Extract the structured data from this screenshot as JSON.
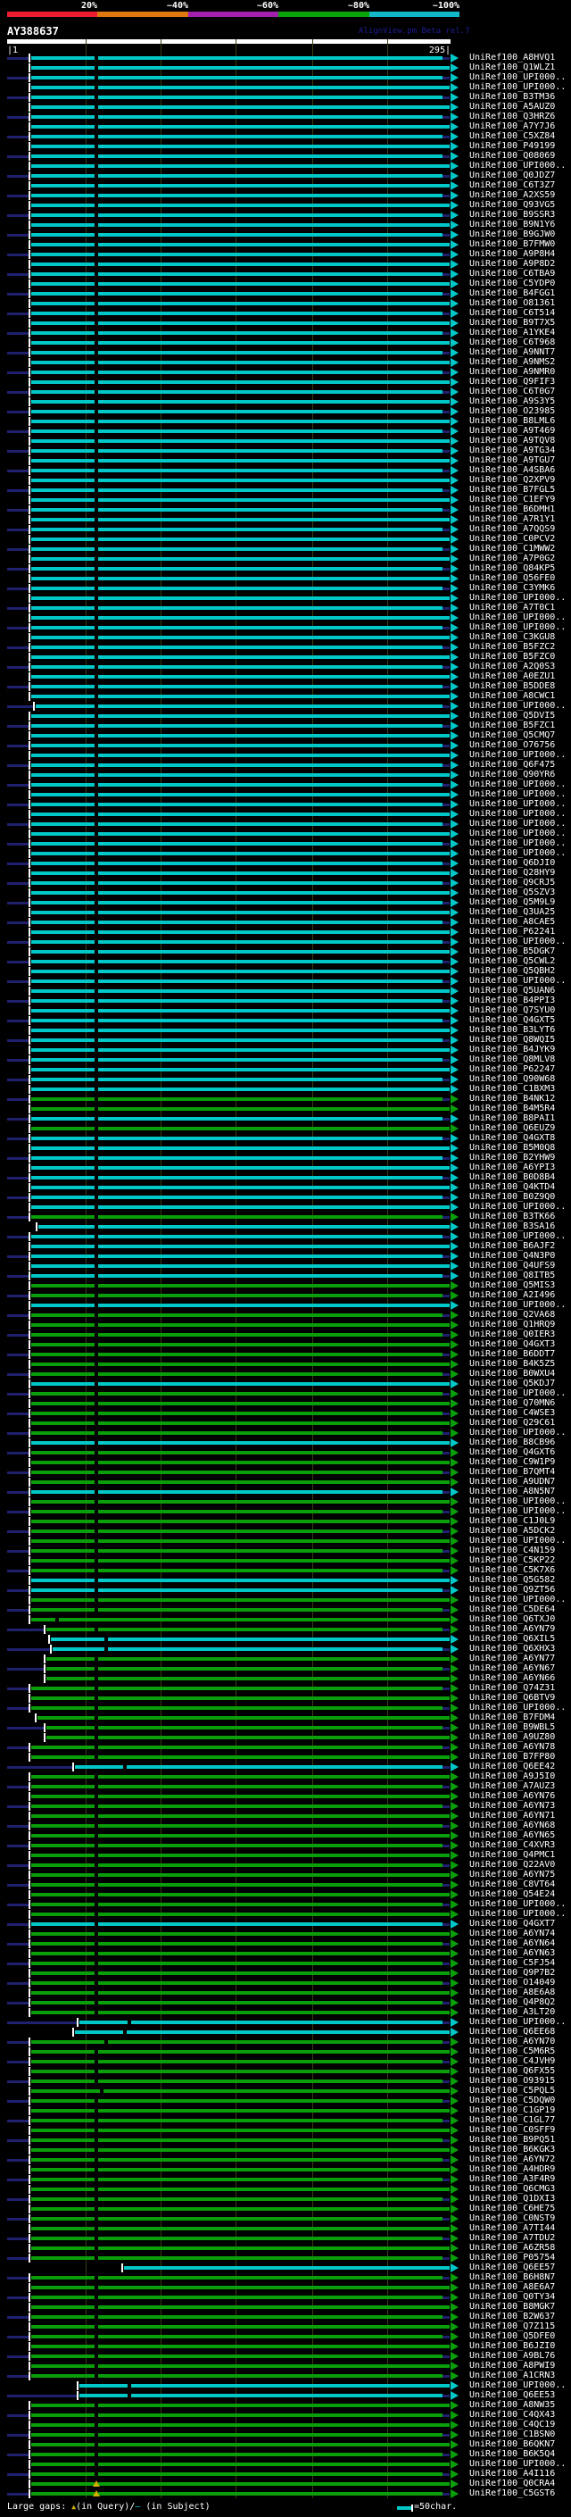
{
  "colors": {
    "background": "#000000",
    "bar_cyan": "#00C8C8",
    "bar_green": "#0A9E0A",
    "overhang_navy": "#20206E",
    "gridline": "#3C3C14",
    "text": "#FFFFFF",
    "watermark": "#1E1E96",
    "gap_marker_yellow": "#D0B000",
    "start_tick": "#FFFFFF"
  },
  "chart_data": {
    "type": "bar",
    "title": "AY388637",
    "watermark": "AlignView.pm Beta rel.7",
    "query_length": 295,
    "axis": {
      "start_label": "|1",
      "end_label": "295|"
    },
    "identity_scale": {
      "labels": [
        "20%",
        "~40%",
        "~60%",
        "~80%",
        "~100%"
      ],
      "colors": [
        "#ED1C2E",
        "#E07810",
        "#A220AA",
        "#0AA40A",
        "#12B8C8"
      ]
    },
    "legend": {
      "large_gaps_prefix": "Large gaps: ",
      "query_gap_symbol": "▲",
      "mid": "(in Query)/",
      "subject_gap_symbol": "—",
      "suffix": " (in Subject)",
      "scale_sample": "=50char."
    },
    "hit_prefix": "UniRef100_",
    "row_fields": [
      "accession",
      "identity_bin",
      "query_start_res",
      "large_gap_res",
      "query_gap_marker"
    ],
    "identity_bins": {
      "c": "~100%",
      "g": "~80%"
    },
    "gridlines_res": [
      53,
      103,
      153,
      204,
      254
    ],
    "rows": [
      [
        "A8HVQ1",
        "c",
        17,
        59
      ],
      [
        "Q1WLZ1",
        "c",
        17,
        59
      ],
      [
        "UPI000..",
        "c",
        17,
        59
      ],
      [
        "UPI000..",
        "c",
        17,
        59
      ],
      [
        "B3TM36",
        "c",
        17,
        59
      ],
      [
        "A5AUZ0",
        "c",
        17,
        59
      ],
      [
        "Q3HRZ6",
        "c",
        17,
        59
      ],
      [
        "A7Y7J6",
        "c",
        17,
        59
      ],
      [
        "C5XZ84",
        "c",
        17,
        59
      ],
      [
        "P49199",
        "c",
        17,
        59
      ],
      [
        "Q08069",
        "c",
        17,
        59
      ],
      [
        "UPI000..",
        "c",
        17,
        59
      ],
      [
        "Q0JDZ7",
        "c",
        17,
        59
      ],
      [
        "C6T3Z7",
        "c",
        17,
        59
      ],
      [
        "A2XS59",
        "c",
        17,
        59
      ],
      [
        "Q93VG5",
        "c",
        17,
        59
      ],
      [
        "B9SSR3",
        "c",
        17,
        59
      ],
      [
        "B9N1Y6",
        "c",
        17,
        59
      ],
      [
        "B9GJW0",
        "c",
        17,
        59
      ],
      [
        "B7FMW0",
        "c",
        17,
        59
      ],
      [
        "A9P8H4",
        "c",
        17,
        59
      ],
      [
        "A9P8D2",
        "c",
        17,
        59
      ],
      [
        "C6TBA9",
        "c",
        17,
        59
      ],
      [
        "C5YDP0",
        "c",
        17,
        59
      ],
      [
        "B4FGG1",
        "c",
        17,
        59
      ],
      [
        "O81361",
        "c",
        17,
        59
      ],
      [
        "C6T514",
        "c",
        17,
        59
      ],
      [
        "B9T7X5",
        "c",
        17,
        59
      ],
      [
        "A1YKE4",
        "c",
        17,
        59
      ],
      [
        "C6T968",
        "c",
        17,
        59
      ],
      [
        "A9NNT7",
        "c",
        17,
        59
      ],
      [
        "A9NMS2",
        "c",
        17,
        59
      ],
      [
        "A9NMR0",
        "c",
        17,
        59
      ],
      [
        "Q9FIF3",
        "c",
        17,
        59
      ],
      [
        "C6T0G7",
        "c",
        17,
        59
      ],
      [
        "A9S3Y5",
        "c",
        17,
        59
      ],
      [
        "O23985",
        "c",
        17,
        59
      ],
      [
        "B8LML6",
        "c",
        17,
        59
      ],
      [
        "A9T469",
        "c",
        17,
        59
      ],
      [
        "A9TQV8",
        "c",
        17,
        59
      ],
      [
        "A9TG34",
        "c",
        17,
        59
      ],
      [
        "A9TGU7",
        "c",
        17,
        59
      ],
      [
        "A4SBA6",
        "c",
        17,
        59
      ],
      [
        "Q2XPV9",
        "c",
        17,
        59
      ],
      [
        "B7FGL5",
        "c",
        17,
        59
      ],
      [
        "C1EFY9",
        "c",
        17,
        59
      ],
      [
        "B6DMH1",
        "c",
        17,
        59
      ],
      [
        "A7R1Y1",
        "c",
        17,
        59
      ],
      [
        "A7QQS9",
        "c",
        17,
        59
      ],
      [
        "C0PCV2",
        "c",
        17,
        59
      ],
      [
        "C1MWW2",
        "c",
        17,
        59
      ],
      [
        "A7P0G2",
        "c",
        17,
        59
      ],
      [
        "Q84KP5",
        "c",
        17,
        59
      ],
      [
        "Q56FE0",
        "c",
        17,
        59
      ],
      [
        "C3YMK6",
        "c",
        17,
        59
      ],
      [
        "UPI000..",
        "c",
        17,
        59
      ],
      [
        "A7T0C1",
        "c",
        17,
        59
      ],
      [
        "UPI000..",
        "c",
        17,
        59
      ],
      [
        "UPI000..",
        "c",
        17,
        59
      ],
      [
        "C3KGU8",
        "c",
        17,
        59
      ],
      [
        "B5FZC2",
        "c",
        17,
        59
      ],
      [
        "B5FZC0",
        "c",
        17,
        59
      ],
      [
        "A2Q0S3",
        "c",
        17,
        59
      ],
      [
        "A0EZU1",
        "c",
        17,
        59
      ],
      [
        "B5DDE8",
        "c",
        17,
        59
      ],
      [
        "A8CWC1",
        "c",
        17,
        59
      ],
      [
        "UPI000..",
        "c",
        20,
        59
      ],
      [
        "Q5DVI5",
        "c",
        17,
        59
      ],
      [
        "B5FZC1",
        "c",
        17,
        59
      ],
      [
        "Q5CMQ7",
        "c",
        17,
        59
      ],
      [
        "O76756",
        "c",
        17,
        59
      ],
      [
        "UPI000..",
        "c",
        17,
        59
      ],
      [
        "Q6F475",
        "c",
        17,
        59
      ],
      [
        "Q90YR6",
        "c",
        17,
        59
      ],
      [
        "UPI000..",
        "c",
        17,
        59
      ],
      [
        "UPI000..",
        "c",
        17,
        59
      ],
      [
        "UPI000..",
        "c",
        17,
        59
      ],
      [
        "UPI000..",
        "c",
        17,
        59
      ],
      [
        "UPI000..",
        "c",
        17,
        59
      ],
      [
        "UPI000..",
        "c",
        17,
        59
      ],
      [
        "UPI000..",
        "c",
        17,
        59
      ],
      [
        "UPI000..",
        "c",
        17,
        59
      ],
      [
        "Q6DJI0",
        "c",
        17,
        59
      ],
      [
        "Q28HY9",
        "c",
        17,
        59
      ],
      [
        "Q9CRJ5",
        "c",
        17,
        59
      ],
      [
        "Q5SZV3",
        "c",
        17,
        59
      ],
      [
        "Q5M9L9",
        "c",
        17,
        59
      ],
      [
        "Q3UA25",
        "c",
        17,
        59
      ],
      [
        "A8CAE5",
        "c",
        17,
        59
      ],
      [
        "P62241",
        "c",
        17,
        59
      ],
      [
        "UPI000..",
        "c",
        17,
        59
      ],
      [
        "B5DGK7",
        "c",
        17,
        59
      ],
      [
        "Q5CWL2",
        "c",
        17,
        59
      ],
      [
        "Q5QBH2",
        "c",
        17,
        59
      ],
      [
        "UPI000..",
        "c",
        17,
        59
      ],
      [
        "Q5UAN6",
        "c",
        17,
        59
      ],
      [
        "B4PPI3",
        "c",
        17,
        59
      ],
      [
        "Q7SYU0",
        "c",
        17,
        59
      ],
      [
        "Q4GXT5",
        "c",
        17,
        59
      ],
      [
        "B3LYT6",
        "c",
        17,
        59
      ],
      [
        "Q8WQI5",
        "c",
        17,
        59
      ],
      [
        "B4JYK9",
        "c",
        17,
        59
      ],
      [
        "Q8MLV8",
        "c",
        17,
        59
      ],
      [
        "P62247",
        "c",
        17,
        59
      ],
      [
        "Q90W68",
        "c",
        17,
        59
      ],
      [
        "C1BXM3",
        "c",
        17,
        59
      ],
      [
        "B4NK12",
        "g",
        17,
        59
      ],
      [
        "B4M5R4",
        "g",
        17,
        59
      ],
      [
        "B8PAI1",
        "c",
        17,
        59
      ],
      [
        "Q6EUZ9",
        "g",
        17,
        59
      ],
      [
        "Q4GXT8",
        "c",
        17,
        59
      ],
      [
        "B5M0Q8",
        "c",
        17,
        59
      ],
      [
        "B2YHW9",
        "c",
        17,
        59
      ],
      [
        "A6YPI3",
        "c",
        17,
        59
      ],
      [
        "B0D8B4",
        "c",
        17,
        59
      ],
      [
        "Q4KTD4",
        "c",
        17,
        59
      ],
      [
        "B0Z9Q0",
        "c",
        17,
        59
      ],
      [
        "UPI000..",
        "c",
        17,
        59
      ],
      [
        "B3TK66",
        "g",
        17,
        59
      ],
      [
        "B3SA16",
        "c",
        22,
        59
      ],
      [
        "UPI000..",
        "c",
        17,
        59
      ],
      [
        "B6AJF2",
        "c",
        17,
        59
      ],
      [
        "Q4N3P0",
        "c",
        17,
        59
      ],
      [
        "Q4UFS9",
        "c",
        17,
        59
      ],
      [
        "Q8ITB5",
        "c",
        17,
        59
      ],
      [
        "Q5MIS3",
        "g",
        17,
        59
      ],
      [
        "A2I496",
        "g",
        17,
        59
      ],
      [
        "UPI000..",
        "c",
        17,
        59
      ],
      [
        "Q2VA68",
        "g",
        17,
        59
      ],
      [
        "Q1HRQ9",
        "g",
        17,
        59
      ],
      [
        "Q0IER3",
        "g",
        17,
        59
      ],
      [
        "Q4GXT3",
        "g",
        17,
        59
      ],
      [
        "B6DDT7",
        "g",
        17,
        59
      ],
      [
        "B4K5Z5",
        "g",
        17,
        59
      ],
      [
        "B0WXU4",
        "g",
        17,
        59
      ],
      [
        "Q5KDJ7",
        "c",
        17,
        59
      ],
      [
        "UPI000..",
        "g",
        17,
        59
      ],
      [
        "Q70MN6",
        "g",
        17,
        59
      ],
      [
        "C4WSE3",
        "g",
        17,
        59
      ],
      [
        "Q29C61",
        "g",
        17,
        59
      ],
      [
        "UPI000..",
        "g",
        17,
        59
      ],
      [
        "B8CB96",
        "c",
        17,
        59
      ],
      [
        "Q4GXT6",
        "g",
        17,
        59
      ],
      [
        "C9W1P9",
        "g",
        17,
        59
      ],
      [
        "B7QMT4",
        "g",
        17,
        59
      ],
      [
        "A9UDN7",
        "g",
        17,
        59
      ],
      [
        "A8N5N7",
        "c",
        17,
        59
      ],
      [
        "UPI000..",
        "g",
        17,
        59
      ],
      [
        "UPI000..",
        "g",
        17,
        59
      ],
      [
        "C1J0L9",
        "g",
        17,
        59
      ],
      [
        "A5DCK2",
        "g",
        17,
        59
      ],
      [
        "UPI000..",
        "g",
        17,
        59
      ],
      [
        "C4N159",
        "g",
        17,
        59
      ],
      [
        "C5KP22",
        "g",
        17,
        59
      ],
      [
        "C5K7X6",
        "g",
        17,
        59
      ],
      [
        "Q5G582",
        "c",
        17,
        59
      ],
      [
        "Q9ZT56",
        "c",
        17,
        59
      ],
      [
        "UPI000..",
        "g",
        17,
        59
      ],
      [
        "C5DE64",
        "g",
        17,
        59
      ],
      [
        "Q6TXJ0",
        "g",
        17,
        33
      ],
      [
        "A6YN79",
        "g",
        27,
        59
      ],
      [
        "Q6XIL5",
        "c",
        30,
        66
      ],
      [
        "Q6XHX3",
        "c",
        31,
        66
      ],
      [
        "A6YN77",
        "g",
        27,
        59
      ],
      [
        "A6YN67",
        "g",
        27,
        59
      ],
      [
        "A6YN66",
        "g",
        27,
        59
      ],
      [
        "Q74Z31",
        "g",
        17,
        59
      ],
      [
        "Q6BTV9",
        "g",
        17,
        59
      ],
      [
        "UPI000..",
        "g",
        17,
        59
      ],
      [
        "B7FDM4",
        "g",
        21,
        59
      ],
      [
        "B9WBL5",
        "g",
        27,
        59
      ],
      [
        "A9UZ80",
        "g",
        27,
        59
      ],
      [
        "A6YN78",
        "g",
        17,
        59
      ],
      [
        "B7FP80",
        "g",
        17,
        59
      ],
      [
        "Q6EE42",
        "c",
        46,
        78
      ],
      [
        "A9J5I0",
        "g",
        17,
        59
      ],
      [
        "A7AUZ3",
        "g",
        17,
        59
      ],
      [
        "A6YN76",
        "g",
        17,
        59
      ],
      [
        "A6YN73",
        "g",
        17,
        59
      ],
      [
        "A6YN71",
        "g",
        17,
        59
      ],
      [
        "A6YN68",
        "g",
        17,
        59
      ],
      [
        "A6YN65",
        "g",
        17,
        59
      ],
      [
        "C4XVR3",
        "g",
        17,
        59
      ],
      [
        "Q4PMC1",
        "g",
        17,
        59
      ],
      [
        "Q22AV0",
        "g",
        17,
        59
      ],
      [
        "A6YN75",
        "g",
        17,
        59
      ],
      [
        "C8VT64",
        "g",
        17,
        59
      ],
      [
        "Q54E24",
        "g",
        17,
        59
      ],
      [
        "UPI000..",
        "g",
        17,
        59
      ],
      [
        "UPI000..",
        "g",
        17,
        59
      ],
      [
        "Q4GXT7",
        "c",
        17,
        59
      ],
      [
        "A6YN74",
        "g",
        17,
        59
      ],
      [
        "A6YN64",
        "g",
        17,
        59
      ],
      [
        "A6YN63",
        "g",
        17,
        59
      ],
      [
        "C5FJ54",
        "g",
        17,
        59
      ],
      [
        "Q9P7B2",
        "g",
        17,
        59
      ],
      [
        "O14049",
        "g",
        17,
        59
      ],
      [
        "A8E6A8",
        "g",
        17,
        59
      ],
      [
        "Q4P8Q2",
        "g",
        17,
        59
      ],
      [
        "A3LT20",
        "g",
        17,
        59
      ],
      [
        "UPI000..",
        "c",
        49,
        81
      ],
      [
        "Q6EE68",
        "c",
        46,
        78
      ],
      [
        "A6YN70",
        "g",
        17,
        66
      ],
      [
        "C5M6R5",
        "g",
        17,
        59
      ],
      [
        "C4JVH9",
        "g",
        17,
        59
      ],
      [
        "Q6FX55",
        "g",
        17,
        59
      ],
      [
        "O93915",
        "g",
        17,
        59
      ],
      [
        "C5PQL5",
        "g",
        17,
        63
      ],
      [
        "C5DQW0",
        "g",
        17,
        59
      ],
      [
        "C1GP19",
        "g",
        17,
        59
      ],
      [
        "C1GL77",
        "g",
        17,
        59
      ],
      [
        "C0SFF9",
        "g",
        17,
        59
      ],
      [
        "B9PQ51",
        "g",
        17,
        59
      ],
      [
        "B6KGK3",
        "g",
        17,
        59
      ],
      [
        "A6YN72",
        "g",
        17,
        59
      ],
      [
        "A4HDR9",
        "g",
        17,
        59
      ],
      [
        "A3F4R9",
        "g",
        17,
        59
      ],
      [
        "Q6CMG3",
        "g",
        17,
        59
      ],
      [
        "Q1DXI3",
        "g",
        17,
        59
      ],
      [
        "C6HE75",
        "g",
        17,
        59
      ],
      [
        "C0NST9",
        "g",
        17,
        59
      ],
      [
        "A7TI44",
        "g",
        17,
        59
      ],
      [
        "A7TDU2",
        "g",
        17,
        59
      ],
      [
        "A6ZR58",
        "g",
        17,
        59
      ],
      [
        "P05754",
        "g",
        17,
        59
      ],
      [
        "Q6EE57",
        "c",
        79,
        0
      ],
      [
        "B6H8N7",
        "g",
        17,
        59
      ],
      [
        "A8E6A7",
        "g",
        17,
        59
      ],
      [
        "Q0TY34",
        "g",
        17,
        59
      ],
      [
        "B8MGK7",
        "g",
        17,
        59
      ],
      [
        "B2W637",
        "g",
        17,
        59
      ],
      [
        "Q7Z115",
        "g",
        17,
        59
      ],
      [
        "Q5DFE0",
        "g",
        17,
        59
      ],
      [
        "B6JZI0",
        "g",
        17,
        59
      ],
      [
        "A9BL76",
        "g",
        17,
        59
      ],
      [
        "A8PWI9",
        "g",
        17,
        59
      ],
      [
        "A1CRN3",
        "g",
        17,
        59
      ],
      [
        "UPI000..",
        "c",
        49,
        81
      ],
      [
        "Q6EE53",
        "c",
        49,
        81
      ],
      [
        "A8NW35",
        "g",
        17,
        59
      ],
      [
        "C4QX43",
        "g",
        17,
        59
      ],
      [
        "C4QC19",
        "g",
        17,
        59
      ],
      [
        "C1BSN0",
        "g",
        17,
        59
      ],
      [
        "B6QKN7",
        "g",
        17,
        59
      ],
      [
        "B6K5Q4",
        "g",
        17,
        59
      ],
      [
        "UPI000..",
        "g",
        17,
        59
      ],
      [
        "A4I116",
        "g",
        17,
        59
      ],
      [
        "Q0CRA4",
        "g",
        17,
        59,
        1
      ],
      [
        "C5GST6",
        "g",
        17,
        59,
        1
      ]
    ]
  }
}
